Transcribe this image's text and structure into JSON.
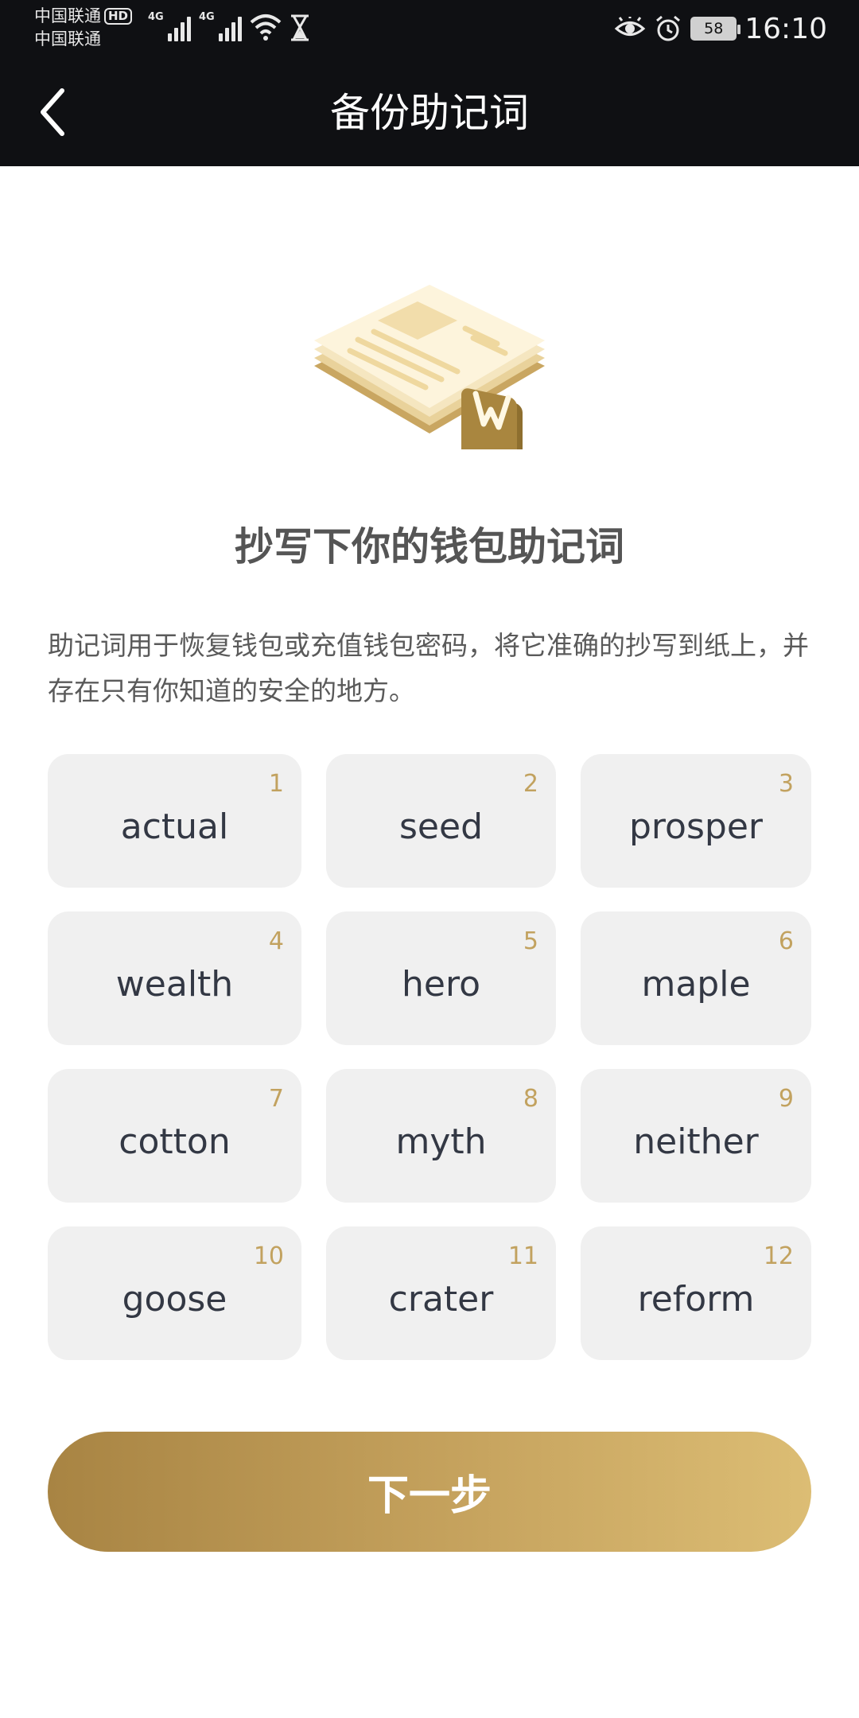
{
  "status_bar": {
    "carrier1": "中国联通",
    "carrier2": "中国联通",
    "hd": "HD",
    "net1": "4G",
    "net2": "4G",
    "battery": "58",
    "time": "16:10"
  },
  "nav": {
    "title": "备份助记词",
    "back_icon": "chevron-left-icon"
  },
  "illustration": "wallet-paper-stack-icon",
  "heading": "抄写下你的钱包助记词",
  "description": "助记词用于恢复钱包或充值钱包密码，将它准确的抄写到纸上，并存在只有你知道的安全的地方。",
  "mnemonic": [
    {
      "word": "actual",
      "num": "1"
    },
    {
      "word": "seed",
      "num": "2"
    },
    {
      "word": "prosper",
      "num": "3"
    },
    {
      "word": "wealth",
      "num": "4"
    },
    {
      "word": "hero",
      "num": "5"
    },
    {
      "word": "maple",
      "num": "6"
    },
    {
      "word": "cotton",
      "num": "7"
    },
    {
      "word": "myth",
      "num": "8"
    },
    {
      "word": "neither",
      "num": "9"
    },
    {
      "word": "goose",
      "num": "10"
    },
    {
      "word": "crater",
      "num": "11"
    },
    {
      "word": "reform",
      "num": "12"
    }
  ],
  "next_button": "下一步",
  "colors": {
    "topbar": "#0f1013",
    "accent_gold": "#c2a25f",
    "cell_bg": "#f0f0f0"
  }
}
